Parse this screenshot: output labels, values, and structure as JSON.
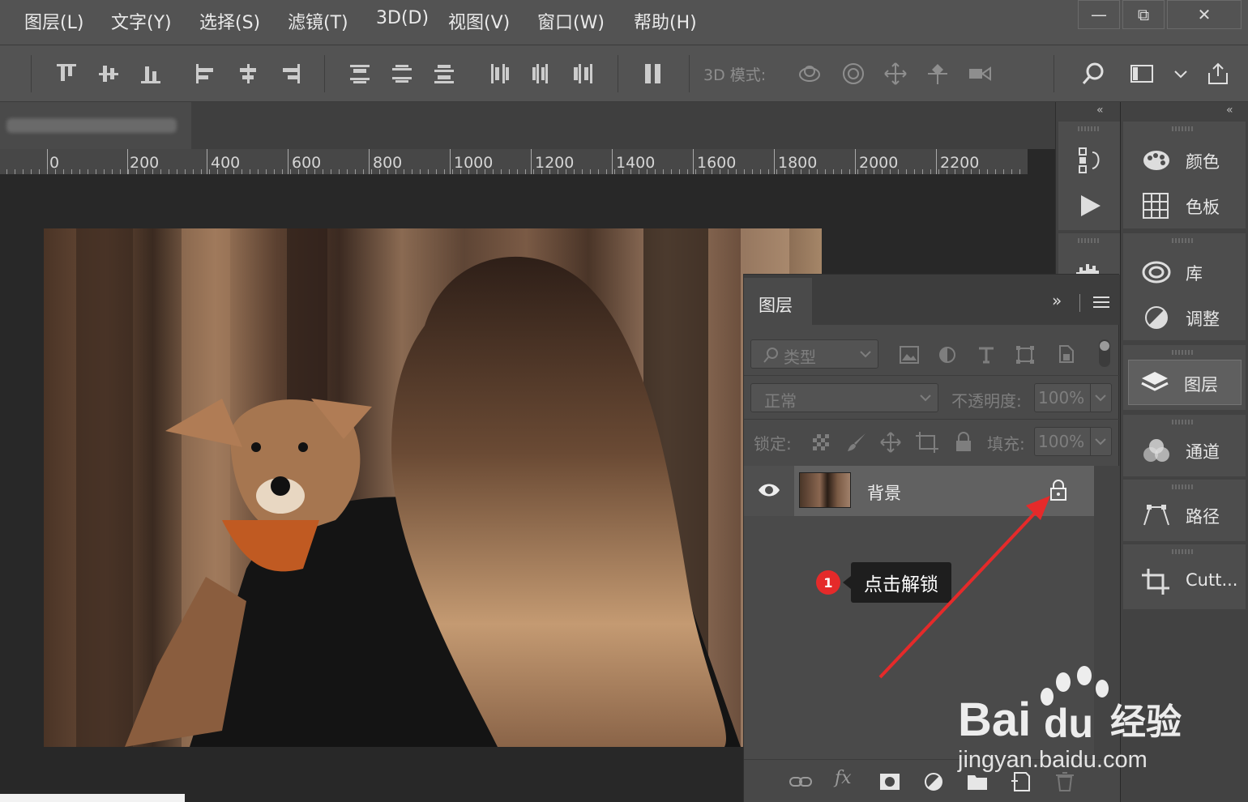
{
  "menu": [
    "图层(L)",
    "文字(Y)",
    "选择(S)",
    "滤镜(T)",
    "3D(D)",
    "视图(V)",
    "窗口(W)",
    "帮助(H)"
  ],
  "window_controls": {
    "minimize": "—",
    "restore": "⧉",
    "close": "✕"
  },
  "options_bar": {
    "mode_3d_label": "3D 模式:"
  },
  "ruler": {
    "labels": [
      "0",
      "200",
      "400",
      "600",
      "800",
      "1000",
      "1200",
      "1400",
      "1600",
      "1800",
      "2000",
      "2200"
    ]
  },
  "dock": {
    "color": "颜色",
    "swatches": "色板",
    "libraries": "库",
    "adjustments": "调整",
    "layers": "图层",
    "channels": "通道",
    "paths": "路径",
    "cutt": "Cutt..."
  },
  "layers_panel": {
    "tab_label": "图层",
    "filter_placeholder": "类型",
    "blend_mode": "正常",
    "opacity_label": "不透明度:",
    "opacity_value": "100%",
    "lock_label": "锁定:",
    "fill_label": "填充:",
    "fill_value": "100%",
    "layer_name": "背景"
  },
  "annotation": {
    "step": "1",
    "text": "点击解锁"
  },
  "watermark": {
    "brand": "Bai",
    "brand2": "du",
    "brand3": "经验",
    "url": "jingyan.baidu.com"
  },
  "colors": {
    "accent_red": "#e52a2a",
    "panel_bg": "#4a4a4a",
    "menu_bg": "#535353"
  }
}
